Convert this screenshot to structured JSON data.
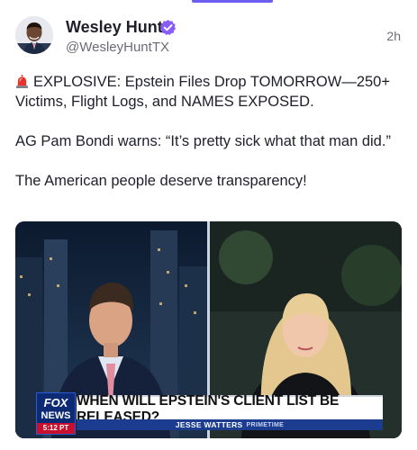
{
  "author": {
    "name": "Wesley Hunt",
    "handle": "@WesleyHuntTX",
    "verified": true
  },
  "post": {
    "timestamp": "2h",
    "paragraphs": [
      "EXPLOSIVE: Epstein Files Drop TOMORROW—250+ Victims, Flight Logs, and NAMES EXPOSED.",
      "AG Pam Bondi warns: “It’s pretty sick what that man did.”",
      "The American people deserve transparency!"
    ]
  },
  "media": {
    "network_logo_top": "FOX",
    "network_logo_bottom": "NEWS",
    "broadcast_time": "5:12 PT",
    "chyron_headline": "WHEN WILL EPSTEIN'S CLIENT LIST BE RELEASED?",
    "show_name": "JESSE WATTERS",
    "show_tag": "PRIMETIME"
  },
  "colors": {
    "accent": "#6d5df0",
    "verified_badge": "#8a5cf6",
    "siren": "#e5322d",
    "fox_blue": "#0d2a74"
  },
  "icons": {
    "verified": "verified-badge-icon",
    "siren": "siren-emoji-icon"
  }
}
